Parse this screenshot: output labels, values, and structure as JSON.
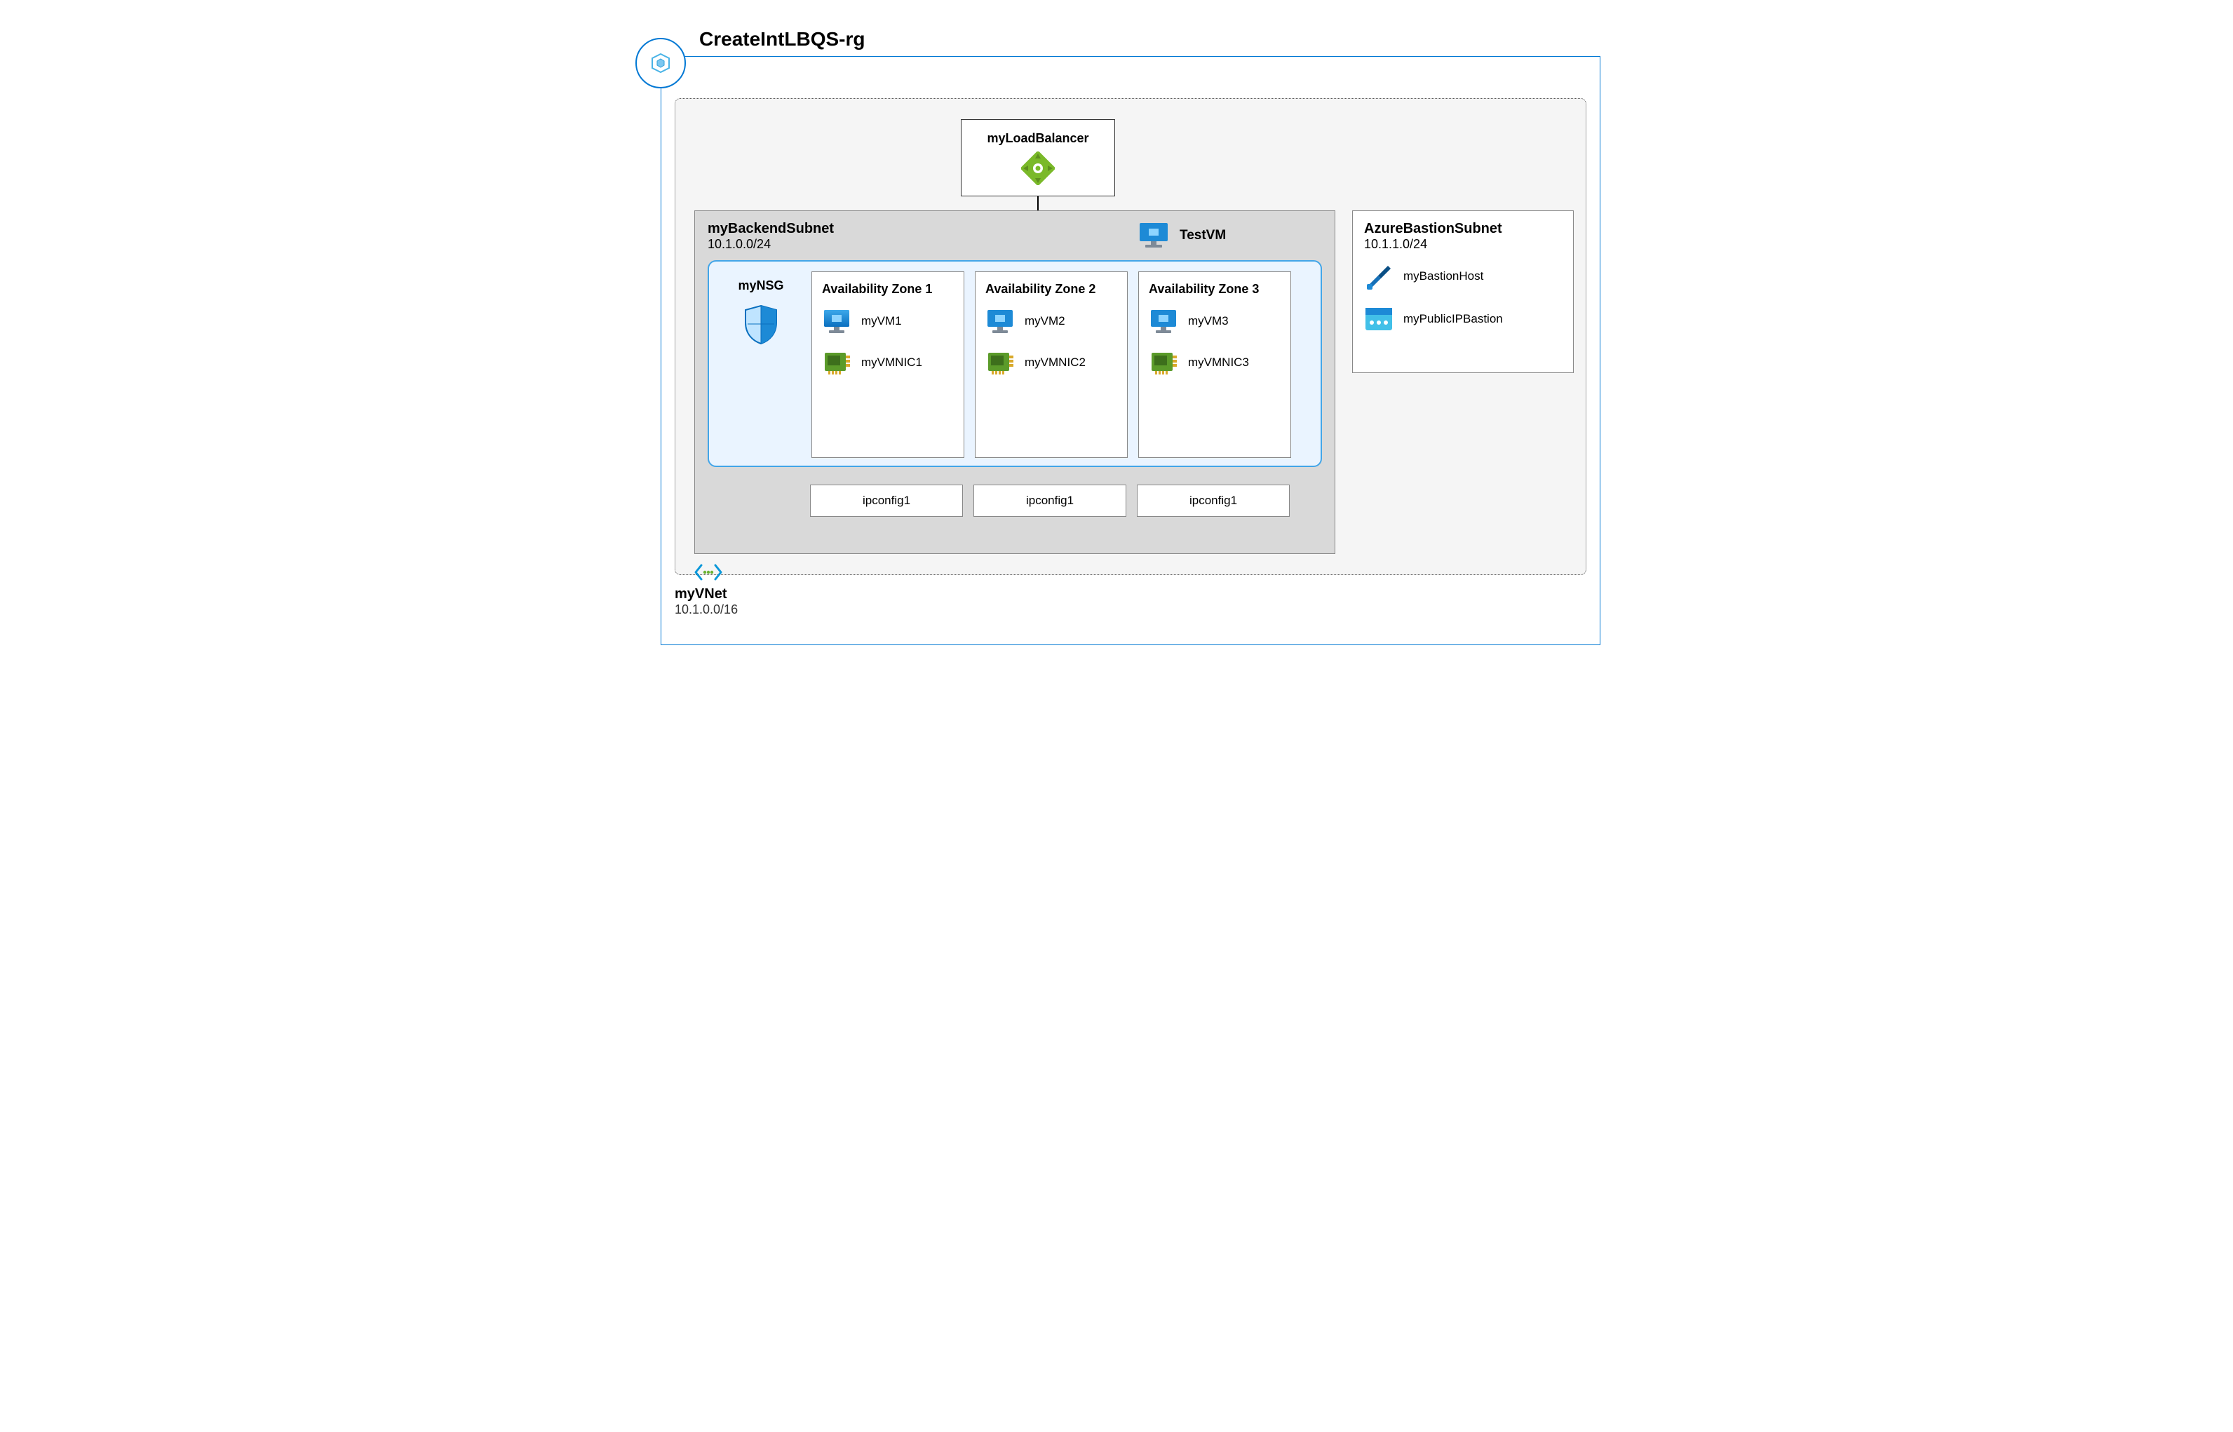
{
  "resource_group": {
    "title": "CreateIntLBQS-rg",
    "icon": "resource-group-icon"
  },
  "vnet": {
    "name": "myVNet",
    "cidr": "10.1.0.0/16",
    "icon": "vnet-icon"
  },
  "load_balancer": {
    "name": "myLoadBalancer",
    "icon": "load-balancer-icon"
  },
  "backend_subnet": {
    "name": "myBackendSubnet",
    "cidr": "10.1.0.0/24"
  },
  "test_vm": {
    "name": "TestVM",
    "icon": "vm-icon"
  },
  "nsg": {
    "name": "myNSG",
    "icon": "shield-icon"
  },
  "availability_zones": [
    {
      "title": "Availability Zone 1",
      "vm": {
        "name": "myVM1",
        "icon": "vm-icon"
      },
      "nic": {
        "name": "myVMNIC1",
        "icon": "nic-icon"
      },
      "ipconfig": "ipconfig1"
    },
    {
      "title": "Availability Zone 2",
      "vm": {
        "name": "myVM2",
        "icon": "vm-icon"
      },
      "nic": {
        "name": "myVMNIC2",
        "icon": "nic-icon"
      },
      "ipconfig": "ipconfig1"
    },
    {
      "title": "Availability Zone 3",
      "vm": {
        "name": "myVM3",
        "icon": "vm-icon"
      },
      "nic": {
        "name": "myVMNIC3",
        "icon": "nic-icon"
      },
      "ipconfig": "ipconfig1"
    }
  ],
  "bastion_subnet": {
    "name": "AzureBastionSubnet",
    "cidr": "10.1.1.0/24",
    "resources": [
      {
        "name": "myBastionHost",
        "icon": "bastion-icon"
      },
      {
        "name": "myPublicIPBastion",
        "icon": "public-ip-icon"
      }
    ]
  },
  "colors": {
    "azure_blue": "#0078d4",
    "light_blue_bg": "#eaf4ff",
    "subnet_gray": "#d9d9d9"
  }
}
